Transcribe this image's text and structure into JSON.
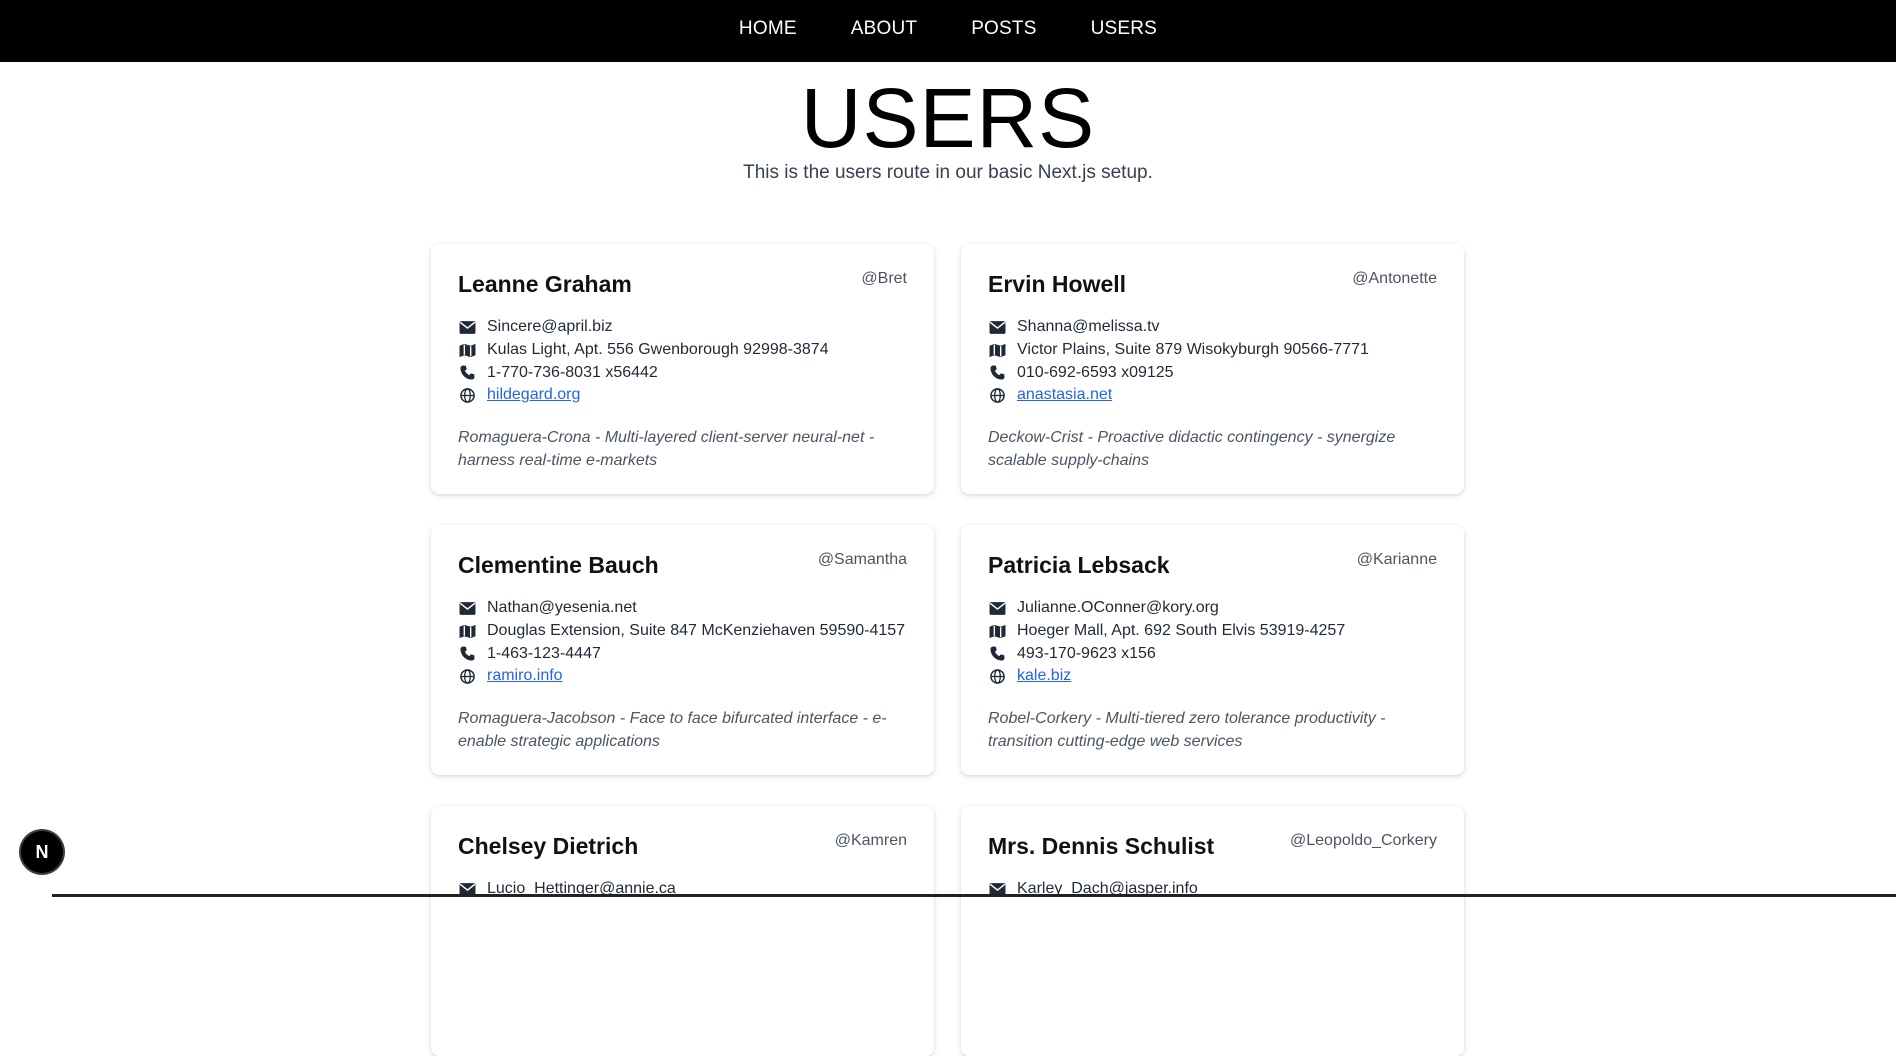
{
  "nav": {
    "items": [
      "HOME",
      "ABOUT",
      "POSTS",
      "USERS"
    ]
  },
  "header": {
    "title": "USERS",
    "subtitle": "This is the users route in our basic Next.js setup."
  },
  "users": [
    {
      "name": "Leanne Graham",
      "username": "@Bret",
      "email": "Sincere@april.biz",
      "address": "Kulas Light, Apt. 556 Gwenborough 92998-3874",
      "phone": "1-770-736-8031 x56442",
      "website": "hildegard.org",
      "company": "Romaguera-Crona - Multi-layered client-server neural-net - harness real-time e-markets"
    },
    {
      "name": "Ervin Howell",
      "username": "@Antonette",
      "email": "Shanna@melissa.tv",
      "address": "Victor Plains, Suite 879 Wisokyburgh 90566-7771",
      "phone": "010-692-6593 x09125",
      "website": "anastasia.net",
      "company": "Deckow-Crist - Proactive didactic contingency - synergize scalable supply-chains"
    },
    {
      "name": "Clementine Bauch",
      "username": "@Samantha",
      "email": "Nathan@yesenia.net",
      "address": "Douglas Extension, Suite 847 McKenziehaven 59590-4157",
      "phone": "1-463-123-4447",
      "website": "ramiro.info",
      "company": "Romaguera-Jacobson - Face to face bifurcated interface - e-enable strategic applications"
    },
    {
      "name": "Patricia Lebsack",
      "username": "@Karianne",
      "email": "Julianne.OConner@kory.org",
      "address": "Hoeger Mall, Apt. 692 South Elvis 53919-4257",
      "phone": "493-170-9623 x156",
      "website": "kale.biz",
      "company": "Robel-Corkery - Multi-tiered zero tolerance productivity - transition cutting-edge web services"
    },
    {
      "name": "Chelsey Dietrich",
      "username": "@Kamren",
      "email": "Lucio_Hettinger@annie.ca",
      "address": "",
      "phone": "",
      "website": "",
      "company": ""
    },
    {
      "name": "Mrs. Dennis Schulist",
      "username": "@Leopoldo_Corkery",
      "email": "Karley_Dach@jasper.info",
      "address": "",
      "phone": "",
      "website": "",
      "company": ""
    }
  ],
  "badge": {
    "letter": "N"
  },
  "icons": {
    "email": "envelope-icon",
    "address": "map-icon",
    "phone": "phone-icon",
    "website": "globe-icon"
  }
}
